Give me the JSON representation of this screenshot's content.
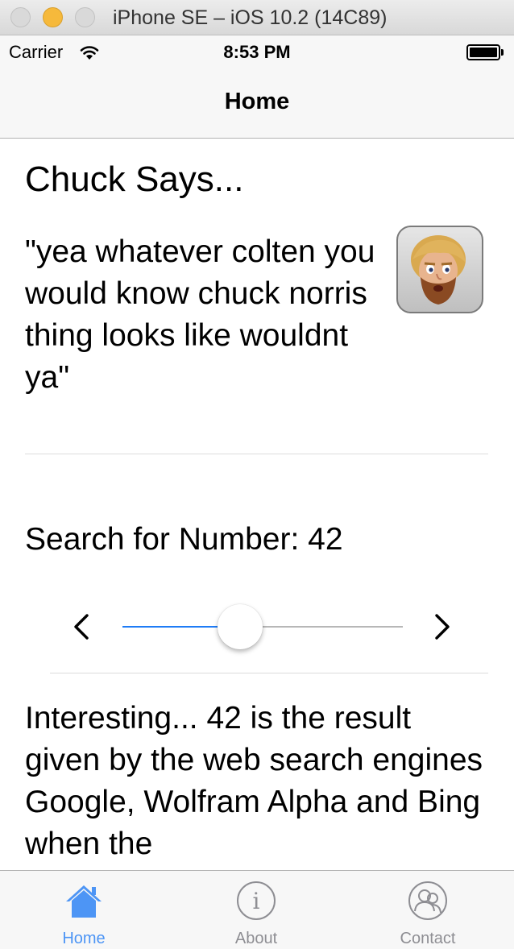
{
  "window": {
    "title": "iPhone SE – iOS 10.2 (14C89)"
  },
  "status_bar": {
    "carrier": "Carrier",
    "time": "8:53 PM",
    "icons": [
      "wifi-icon",
      "battery-icon"
    ]
  },
  "nav": {
    "title": "Home"
  },
  "chuck": {
    "heading": "Chuck Says...",
    "quote": "\"yea whatever colten you would know chuck norris thing looks like wouldnt ya\"",
    "avatar_icon": "chuck-norris-avatar"
  },
  "search": {
    "label": "Search for Number:",
    "value": "42",
    "slider_fraction": 0.42,
    "prev_icon": "chevron-left-icon",
    "next_icon": "chevron-right-icon"
  },
  "fact": {
    "text": "Interesting... 42 is the result given by the web search engines Google, Wolfram Alpha and Bing when the"
  },
  "tabs": [
    {
      "label": "Home",
      "icon": "house-icon",
      "active": true
    },
    {
      "label": "About",
      "icon": "info-icon",
      "active": false
    },
    {
      "label": "Contact",
      "icon": "contacts-icon",
      "active": false
    }
  ],
  "colors": {
    "accent": "#1f7cf6",
    "tab_active": "#4d95f5",
    "tab_inactive": "#8e8e93",
    "minimize": "#f6b93b"
  }
}
